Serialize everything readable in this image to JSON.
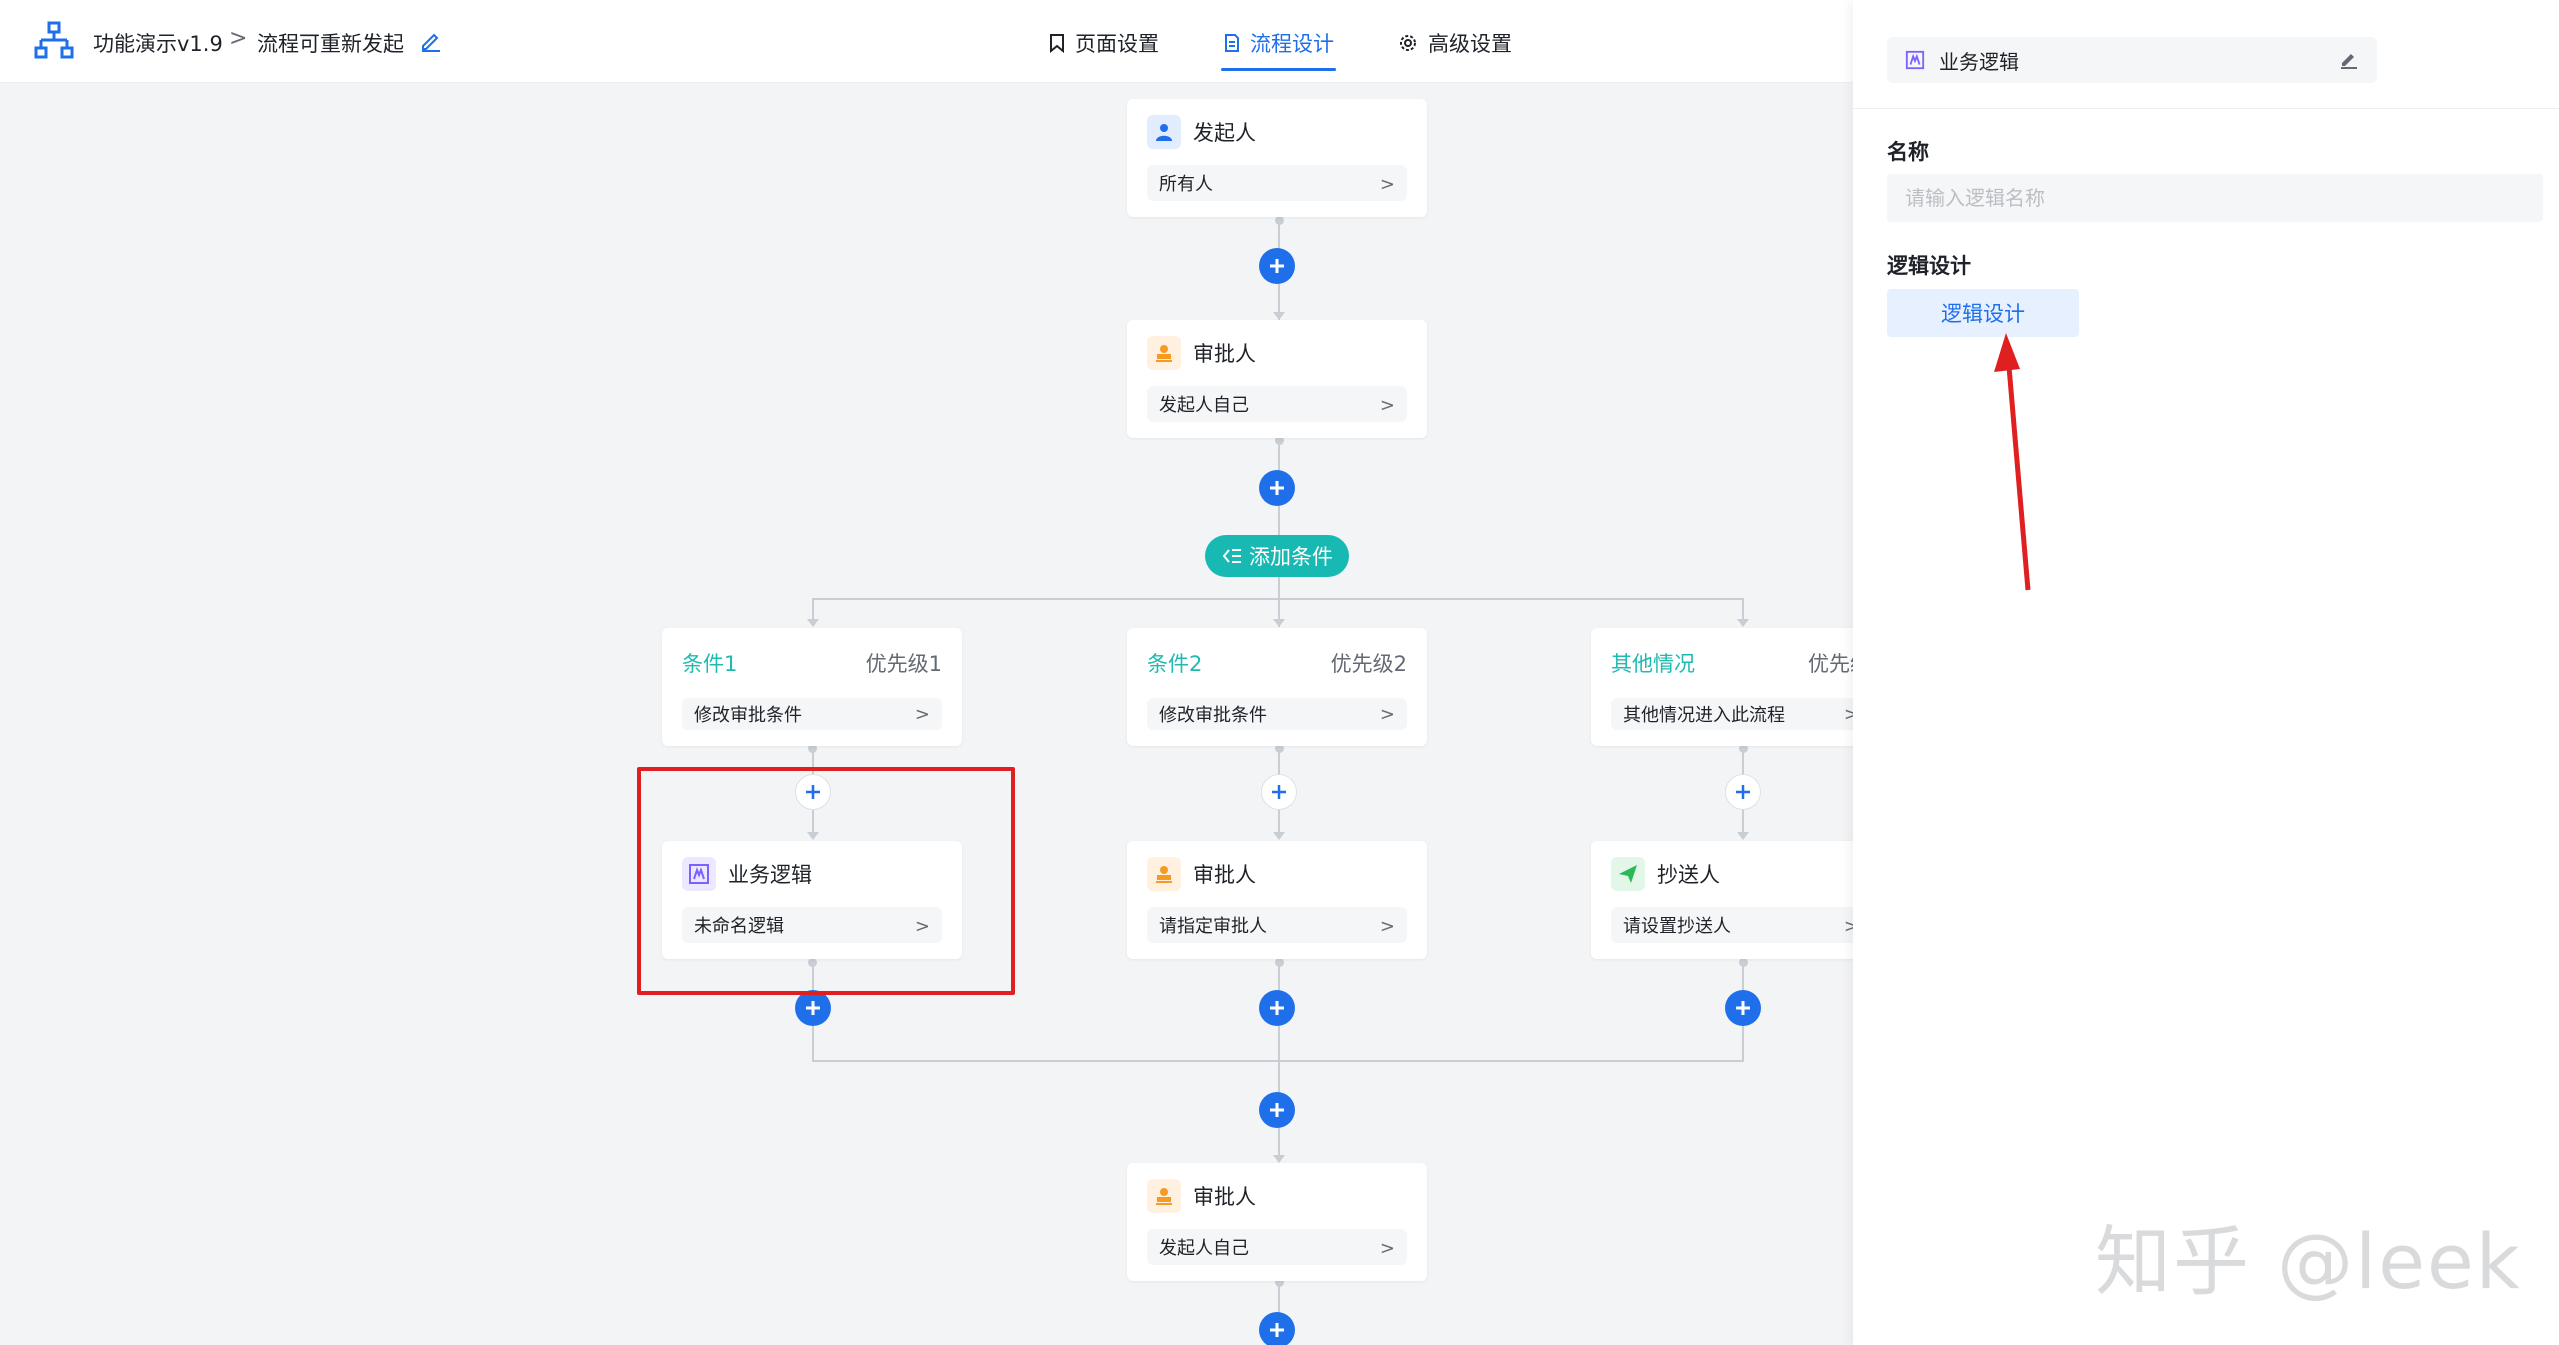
{
  "header": {
    "app_name": "功能演示v1.9",
    "separator": ">",
    "page_name": "流程可重新发起",
    "tabs": [
      {
        "label": "页面设置",
        "icon": "bookmark-icon",
        "active": false
      },
      {
        "label": "流程设计",
        "icon": "document-icon",
        "active": true
      },
      {
        "label": "高级设置",
        "icon": "gear-icon",
        "active": false
      }
    ],
    "accent_color": "#1f6feb"
  },
  "flow": {
    "initiator": {
      "title": "发起人",
      "field": "所有人",
      "icon": "person-icon"
    },
    "approver_1": {
      "title": "审批人",
      "field": "发起人自己",
      "icon": "stamp-icon"
    },
    "add_condition_label": "添加条件",
    "branches": [
      {
        "name": "条件1",
        "priority": "优先级1",
        "field": "修改审批条件",
        "node": {
          "title": "业务逻辑",
          "field": "未命名逻辑",
          "icon": "logic-icon"
        }
      },
      {
        "name": "条件2",
        "priority": "优先级2",
        "field": "修改审批条件",
        "node": {
          "title": "审批人",
          "field": "请指定审批人",
          "icon": "stamp-icon"
        }
      },
      {
        "name": "其他情况",
        "priority": "优先级",
        "field": "其他情况进入此流程",
        "node": {
          "title": "抄送人",
          "field": "请设置抄送人",
          "icon": "send-icon"
        }
      }
    ],
    "approver_final": {
      "title": "审批人",
      "field": "发起人自己",
      "icon": "stamp-icon"
    },
    "condition_color": "#1ebbb1"
  },
  "panel": {
    "title": "业务逻辑",
    "name_label": "名称",
    "name_placeholder": "请输入逻辑名称",
    "name_value": "",
    "logic_label": "逻辑设计",
    "logic_button": "逻辑设计"
  },
  "watermark": "知乎 @leek"
}
